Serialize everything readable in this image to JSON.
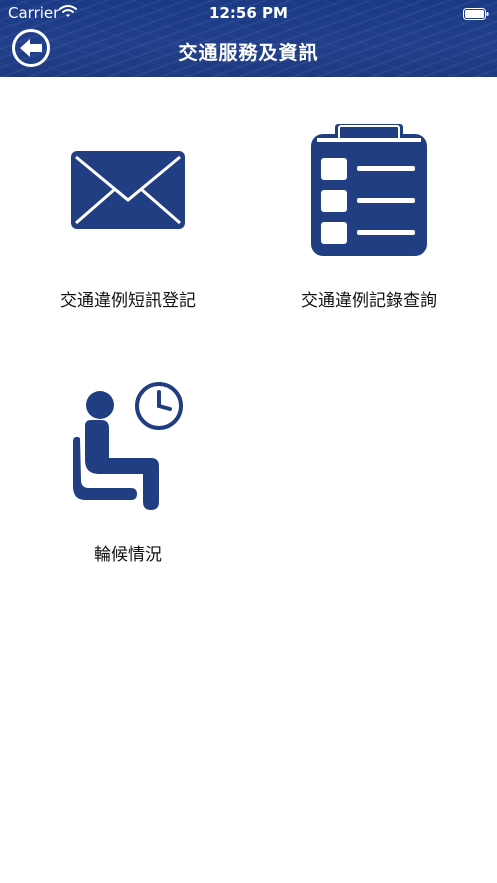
{
  "status_bar": {
    "carrier": "Carrier",
    "time": "12:56 PM"
  },
  "header": {
    "title": "交通服務及資訊",
    "back_icon": "back-arrow-icon"
  },
  "menu": {
    "items": [
      {
        "label": "交通違例短訊登記",
        "icon": "envelope-icon"
      },
      {
        "label": "交通違例記錄查詢",
        "icon": "clipboard-list-icon"
      },
      {
        "label": "輪候情況",
        "icon": "waiting-person-clock-icon"
      }
    ]
  },
  "colors": {
    "header_blue": "#1f3d88",
    "icon_blue": "#213e82"
  }
}
